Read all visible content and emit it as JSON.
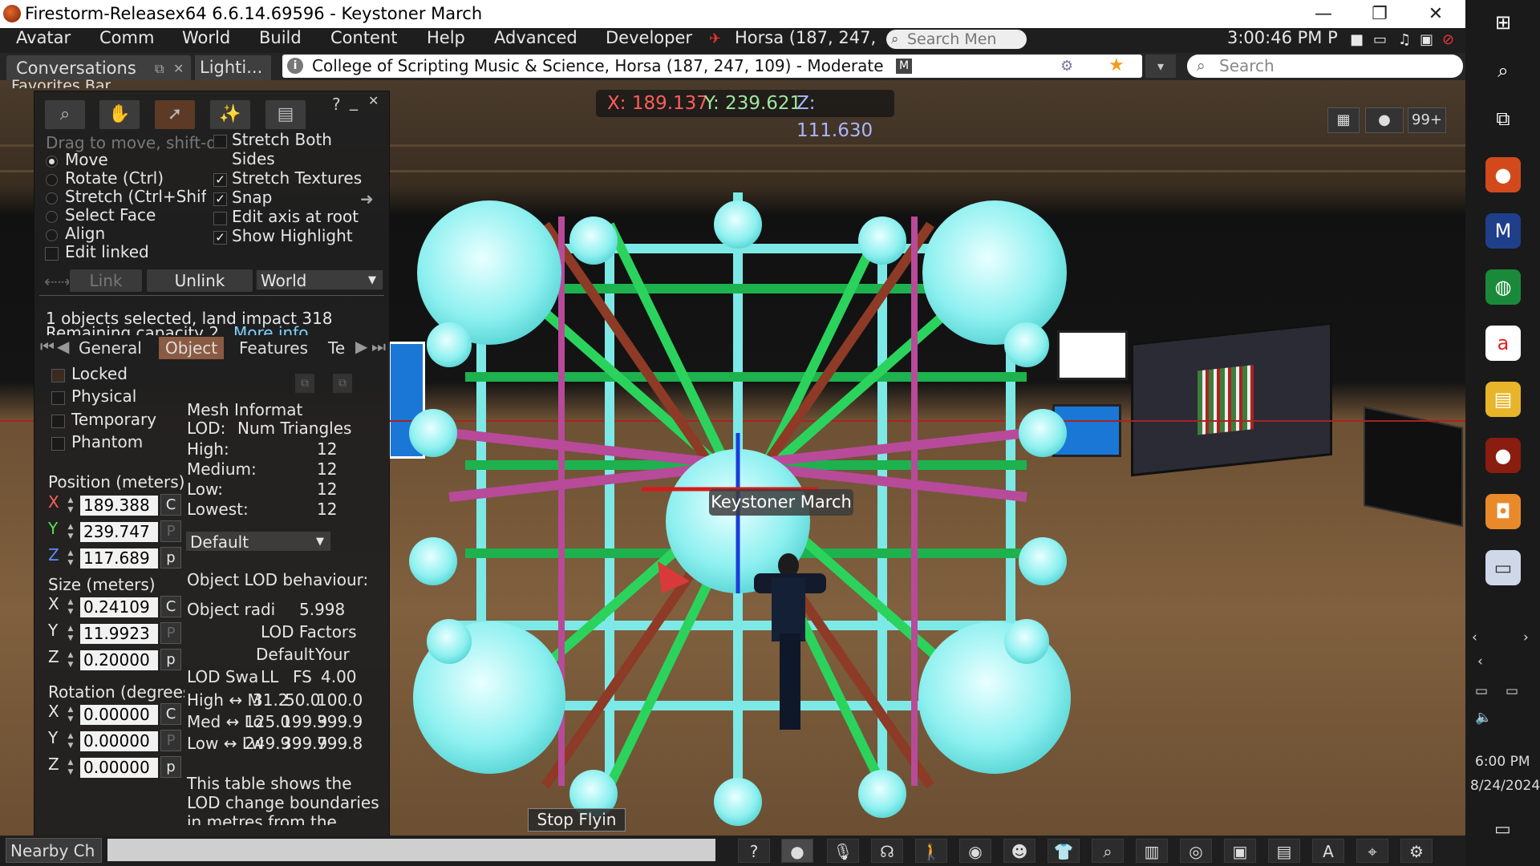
{
  "window": {
    "title": "Firestorm-Releasex64 6.6.14.69596 - Keystoner March",
    "minimize": "—",
    "restore": "❐",
    "close": "✕"
  },
  "menu": {
    "items": [
      "Avatar",
      "Comm",
      "World",
      "Build",
      "Content",
      "Help",
      "Advanced",
      "Developer"
    ],
    "location": "Horsa (187, 247,",
    "search_placeholder": "Search Men",
    "clock": "3:00:46 PM P"
  },
  "nav": {
    "tab_conversations": "Conversations",
    "tab_lighting": "Lighti...",
    "favorites": "Favorites Bar",
    "location_text": "College of Scripting Music & Science, Horsa (187, 247, 109) - Moderate",
    "maturity_badge": "M",
    "search_placeholder": "Search"
  },
  "viewport": {
    "coords": {
      "x": "X: 189.137",
      "y": "Y: 239.621",
      "z": "Z: 111.630"
    },
    "avatar_name": "Keystoner March",
    "stop_flying": "Stop Flyin",
    "notification_count": "99+"
  },
  "build": {
    "help": "?",
    "minimize": "_",
    "close": "✕",
    "hint": "Drag to move, shift-drag to copy",
    "modes": [
      "Move",
      "Rotate (Ctrl)",
      "Stretch (Ctrl+Shift)",
      "Select Face",
      "Align"
    ],
    "selected_mode": "Move",
    "edit_linked": "Edit linked",
    "checks": [
      {
        "label": "Stretch Both",
        "label2": "Sides",
        "checked": false
      },
      {
        "label": "Stretch Textures",
        "checked": true
      },
      {
        "label": "Snap",
        "checked": true
      },
      {
        "label": "Edit axis at root",
        "checked": false
      },
      {
        "label": "Show Highlight",
        "checked": true
      }
    ],
    "link": "Link",
    "unlink": "Unlink",
    "ref_frame": "World",
    "selection_info": "1 objects selected, land impact 318",
    "remaining": "Remaining capacity 2,",
    "more_info": "More info",
    "tabs": [
      "General",
      "Object",
      "Features",
      "Te"
    ],
    "active_tab": "Object",
    "flags": [
      "Locked",
      "Physical",
      "Temporary",
      "Phantom"
    ],
    "position_label": "Position (meters)",
    "position": [
      "189.388",
      "239.747",
      "117.689"
    ],
    "size_label": "Size (meters)",
    "size": [
      "0.24109",
      "11.9923",
      "0.20000"
    ],
    "rotation_label": "Rotation (degrees)",
    "rotation": [
      "0.00000",
      "0.00000",
      "0.00000"
    ],
    "axis_letters": [
      "X",
      "Y",
      "Z"
    ],
    "btn_c": "C",
    "btn_p": "P",
    "btn_p_lower": "p",
    "mesh_info": "Mesh Informat",
    "lod_head": "LOD:",
    "num_tri_head": "Num Triangles",
    "lod_rows": [
      {
        "name": "High:",
        "tris": "12"
      },
      {
        "name": "Medium:",
        "tris": "12"
      },
      {
        "name": "Low:",
        "tris": "12"
      },
      {
        "name": "Lowest:",
        "tris": "12"
      }
    ],
    "material_default": "Default",
    "object_lod_behaviour": "Object LOD behaviour:",
    "object_radius_label": "Object radi",
    "object_radius": "5.998",
    "lod_factors": "LOD Factors",
    "col_default": "Default",
    "col_your": "Your",
    "lod_swap_head": [
      "LOD Swa",
      "LL",
      "FS",
      "4.00"
    ],
    "lod_swap_rows": [
      {
        "name": "High ↔ M",
        "ll": "31.2",
        "fs": "50.0",
        "your": "100.0"
      },
      {
        "name": "Med ↔ Lo",
        "ll": "125.0",
        "fs": "199.9",
        "your": "399.9"
      },
      {
        "name": "Low ↔ Lw",
        "ll": "249.9",
        "fs": "399.9",
        "your": "799.8"
      }
    ],
    "footer_note": [
      "This table shows the",
      "LOD change boundaries",
      "in metres from the"
    ]
  },
  "bottom": {
    "nearby_chat": "Nearby Ch"
  },
  "taskbar": {
    "time": "6:00 PM",
    "date": "8/24/2024"
  }
}
